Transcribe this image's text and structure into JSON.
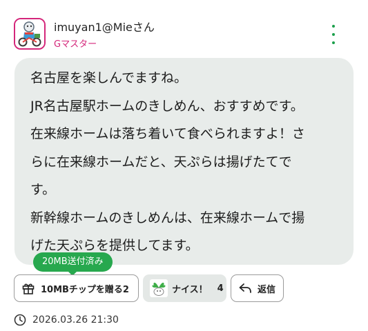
{
  "post": {
    "username": "imuyan1@Mieさん",
    "rank": "Gマスター",
    "body_lines": [
      "名古屋を楽しんでますね。",
      "JR名古屋駅ホームのきしめん、おすすめです。",
      "在来線ホームは落ち着いて食べられますよ！さ",
      "らに在来線ホームだと、天ぷらは揚げたてで",
      "す。",
      "新幹線ホームのきしめんは、在来線ホームで揚",
      "げた天ぷらを提供してます。"
    ],
    "timestamp": "2026.03.26 21:30"
  },
  "actions": {
    "sent_badge": "20MB送付済み",
    "tip_label": "10MBチップを贈る2",
    "nice_label": "ナイス！",
    "nice_count": "4",
    "reply_label": "返信"
  },
  "icons": {
    "avatar": "cyclist-avatar",
    "menu": "kebab-menu-icon",
    "gift": "gift-icon",
    "nice": "nice-sticker-icon",
    "reply": "reply-arrow-icon",
    "clock": "clock-icon"
  },
  "colors": {
    "accent_green": "#27a84e",
    "rank_magenta": "#d4267a",
    "bubble_bg": "#e8ecea"
  }
}
